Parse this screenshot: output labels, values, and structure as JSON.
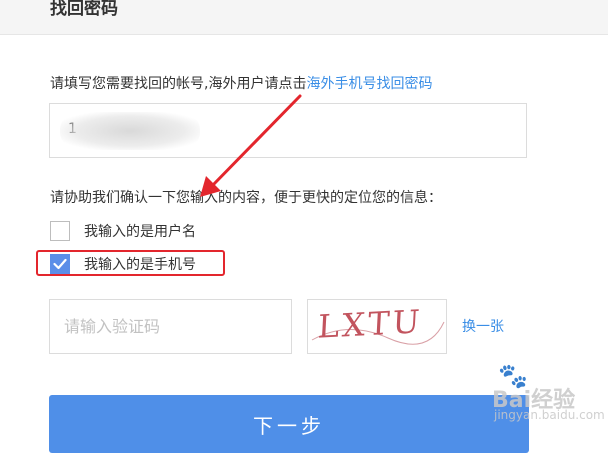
{
  "header": {
    "title": "找回密码"
  },
  "instruction": {
    "text": "请填写您需要找回的帐号,海外用户请点击",
    "link": "海外手机号找回密码"
  },
  "account": {
    "value": "1"
  },
  "helper": {
    "text": "请协助我们确认一下您输入的内容，便于更快的定位您的信息："
  },
  "options": [
    {
      "label": "我输入的是用户名",
      "checked": false
    },
    {
      "label": "我输入的是手机号",
      "checked": true
    }
  ],
  "captcha": {
    "placeholder": "请输入验证码",
    "image_text": "LXTU",
    "refresh_label": "换一张"
  },
  "next_button": {
    "label": "下一步"
  },
  "watermark": {
    "main": "Bai经验",
    "sub": "jingyan.baidu.com"
  },
  "colors": {
    "link": "#3a8ee6",
    "button": "#4f8fe8",
    "checked": "#5b8ee8",
    "annotation": "#e3262d"
  }
}
